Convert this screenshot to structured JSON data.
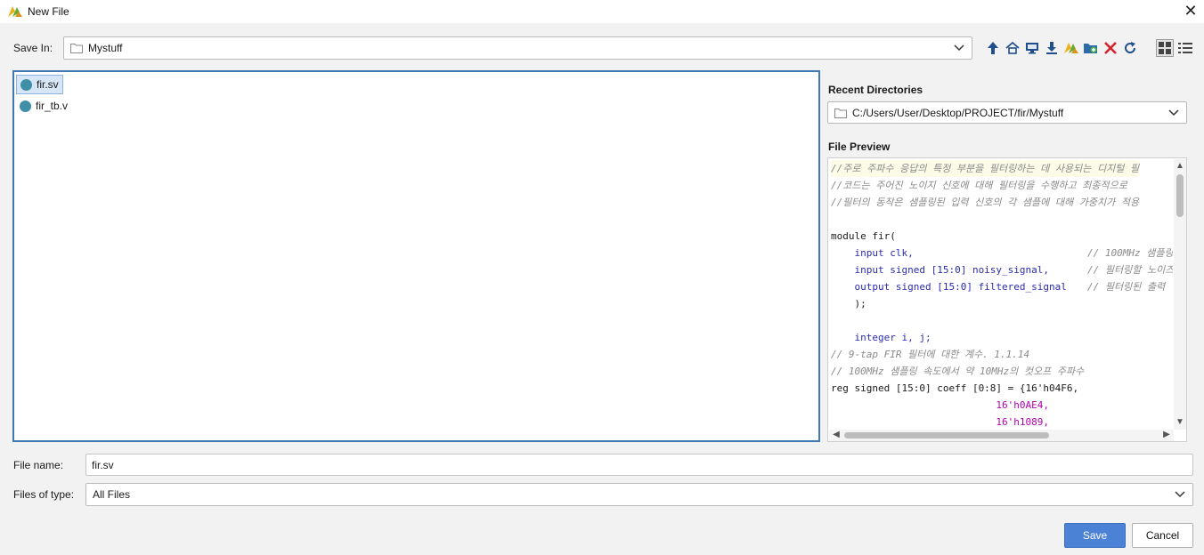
{
  "window": {
    "title": "New File",
    "close_icon": "close-icon"
  },
  "save_in": {
    "label": "Save In:",
    "value": "Mystuff"
  },
  "toolbar": {
    "icons": [
      "up-folder-icon",
      "home-icon",
      "desktop-icon",
      "download-icon",
      "vivado-project-icon",
      "new-folder-icon",
      "delete-icon",
      "refresh-icon",
      "grid-view-icon",
      "list-view-icon"
    ]
  },
  "files": [
    {
      "name": "fir.sv",
      "selected": true
    },
    {
      "name": "fir_tb.v",
      "selected": false
    }
  ],
  "recent": {
    "title": "Recent Directories",
    "value": "C:/Users/User/Desktop/PROJECT/fir/Mystuff"
  },
  "preview": {
    "title": "File Preview",
    "lines": [
      "//주로 주파수 응답의 특정 부분을 필터링하는 데 사용되는 디지털 필",
      "//코드는 주어진 노이지 신호에 대해 필터링을 수행하고 최종적으로",
      "//필터의 동작은 샘플링된 입력 신호의 각 샘플에 대해 가중치가 적용",
      "",
      "module fir(",
      "    input clk,",
      "    input signed [15:0] noisy_signal,",
      "    output signed [15:0] filtered_signal",
      "    );",
      "",
      "    integer i, j;",
      "// 9-tap FIR 필터에 대한 계수. 1.1.14",
      "// 100MHz 샘플링 속도에서 약 10MHz의 컷오프 주파수",
      "reg signed [15:0] coeff [0:8] = {16'h04F6,",
      "                            16'h0AE4,",
      "                            16'h1089,"
    ],
    "right_comments": [
      "// 100MHz 샘플링",
      "// 필터링할 노이즈",
      "// 필터링된 출력"
    ]
  },
  "file_name": {
    "label": "File name:",
    "value": "fir.sv"
  },
  "file_type": {
    "label": "Files of type:",
    "value": "All Files"
  },
  "buttons": {
    "save": "Save",
    "cancel": "Cancel"
  },
  "colors": {
    "accent": "#4c82d6",
    "selection_border": "#3f78b4",
    "file_icon": "#3f8fa8"
  }
}
